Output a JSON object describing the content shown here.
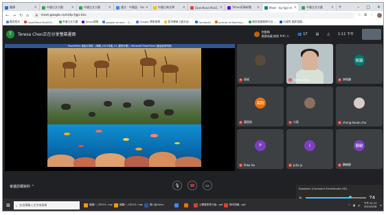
{
  "browser": {
    "tabs": [
      {
        "label": "翻譯",
        "active": false,
        "color": "#1a73e8"
      },
      {
        "label": "中國古文大觀",
        "active": false,
        "color": "#34a853"
      },
      {
        "label": "中國古文大觀",
        "active": false,
        "color": "#34a853"
      },
      {
        "label": "國文 - 中國語 - Goo...",
        "active": false,
        "color": "#4285f4"
      },
      {
        "label": "中國古典文學",
        "active": false,
        "color": "#fbbc04"
      },
      {
        "label": "OpenRead Mail1...",
        "active": false,
        "color": "#ea4335"
      },
      {
        "label": "Yahoo奇摩新聞",
        "active": false,
        "color": "#6001d2"
      },
      {
        "label": "Meet - dp-fjgn-m...",
        "active": true,
        "color": "#00897b"
      },
      {
        "label": "中國古文大觀",
        "active": false,
        "color": "#34a853"
      }
    ],
    "url": "meet.google.com/dp-fjgn-kkv",
    "bookmarks": [
      "應用程式",
      "OpenRead Mail201...",
      "中國古文大觀",
      "Yahoo奇摩",
      "google scholar - G...",
      "Google 學術搜尋",
      "臺灣博碩士論文加...",
      "Facebook",
      "Journal of Banking...",
      "國家圖書館期刊文...",
      "行政院 國家發展..."
    ]
  },
  "meet": {
    "presenter_initial": "T",
    "presenting_text": "Teresa Chen正在分享螢幕畫面",
    "user_name_line1": "許凱翰",
    "user_name_line2": "邀請成員(其他 ##) 人",
    "participants_count": "17",
    "time": "1:11 下午",
    "ppt_title": "PowerPoint 投影片放映 - [專題_2021年度_V.1_動物分類] - Microsoft PowerPoint (產品啟用失敗)",
    "participants": [
      {
        "name": "遊叔",
        "initial": "",
        "avatar_color": "#5a4a3a",
        "type": "photo"
      },
      {
        "name": "Teresa Chen",
        "initial": "",
        "avatar_color": "",
        "type": "video"
      },
      {
        "name": "李佩穎",
        "initial": "佩穎",
        "avatar_color": "#00796b",
        "type": "initial"
      },
      {
        "name": "蕭思鈞",
        "initial": "亮昀",
        "avatar_color": "#e8710a",
        "type": "initial"
      },
      {
        "name": "小鈺",
        "initial": "",
        "avatar_color": "#8d6e63",
        "type": "photo"
      },
      {
        "name": "cheng hsuan chu",
        "initial": "",
        "avatar_color": "#d7ccc8",
        "type": "photo"
      },
      {
        "name": "Peko Hu",
        "initial": "P",
        "avatar_color": "#7b3fbf",
        "type": "initial"
      },
      {
        "name": "Julia ju",
        "initial": "J",
        "avatar_color": "#7b3fbf",
        "type": "initial"
      },
      {
        "name": "靜緹緹",
        "initial": "靜緹",
        "avatar_color": "#7b3fbf",
        "type": "initial"
      }
    ],
    "meeting_details_label": "會議詳細資料 ^"
  },
  "volume": {
    "device": "Speakers (Conexant SmartAudio HD)",
    "level": "74",
    "level_fraction": 0.74
  },
  "taskbar": {
    "search_placeholder": "在這裡輸入文字來搜尋",
    "items": [
      {
        "label": "線圖一_20210...mp4",
        "color": "#ff9800"
      },
      {
        "label": "線圖一_20210...mp4",
        "color": "#ff9800"
      },
      {
        "label": "第八組.docx",
        "color": "#2b579a"
      },
      {
        "label": "",
        "color": "#4285f4"
      },
      {
        "label": "",
        "color": "#e8710a"
      },
      {
        "label": "公開發表會介紹...ppt",
        "color": "#d24726"
      },
      {
        "label": "期中簡報...ppt",
        "color": "#d24726"
      }
    ],
    "clock_time": "下午 01:11",
    "clock_date": "2021/5/18"
  }
}
